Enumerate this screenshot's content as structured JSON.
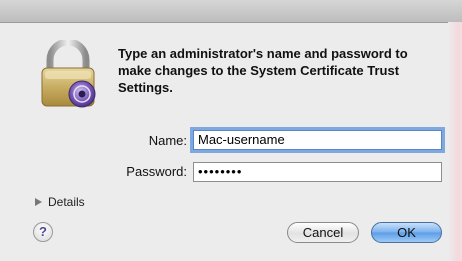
{
  "dialog": {
    "message": "Type an administrator's name and password to make changes to the System Certificate Trust Settings.",
    "name_label": "Name:",
    "name_value": "Mac-username",
    "password_label": "Password:",
    "password_value": "••••••••",
    "details_label": "Details",
    "help_label": "?",
    "cancel_label": "Cancel",
    "ok_label": "OK"
  },
  "icons": {
    "lock": "lock-icon",
    "details_toggle": "disclosure-triangle-icon",
    "help": "help-icon"
  },
  "colors": {
    "window_bg": "#ececec",
    "focus_ring": "#7fa8e0",
    "default_button": "#5c9ce6"
  }
}
